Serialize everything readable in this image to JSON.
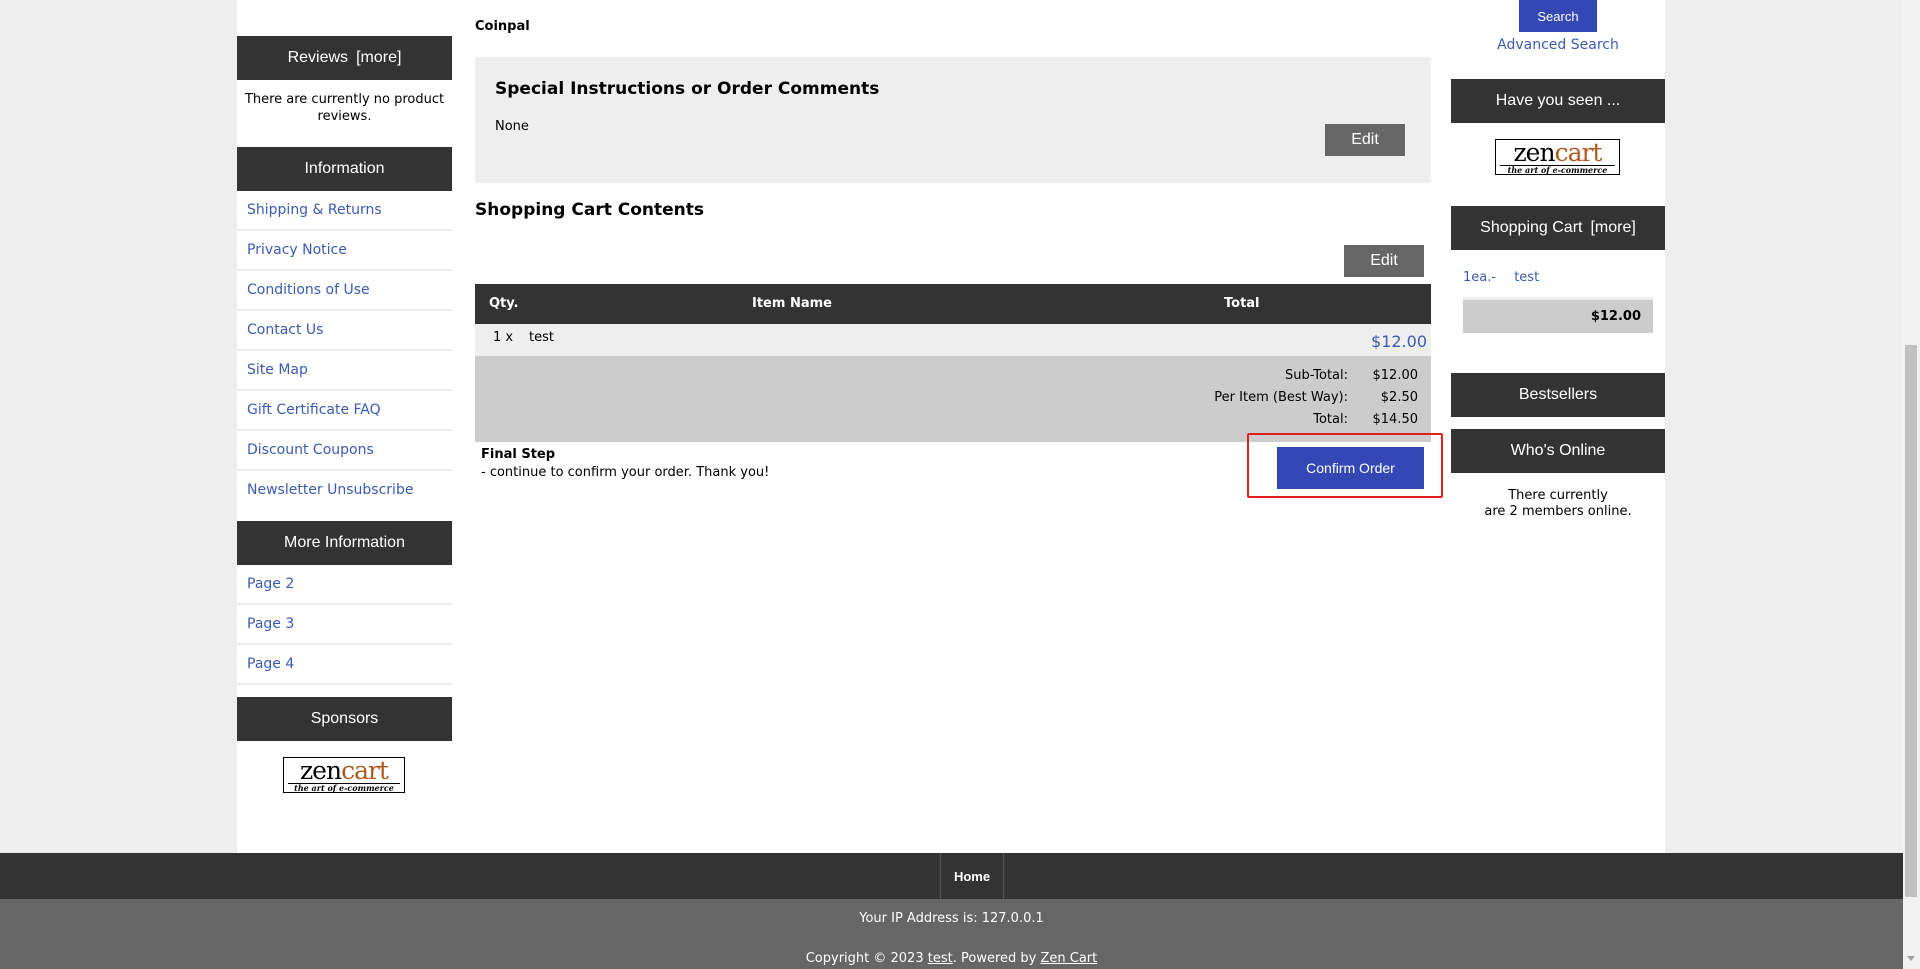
{
  "left": {
    "reviews": {
      "title": "Reviews",
      "more": "[more]",
      "text": "There are currently no product reviews."
    },
    "information": {
      "title": "Information",
      "items": [
        "Shipping & Returns",
        "Privacy Notice",
        "Conditions of Use",
        "Contact Us",
        "Site Map",
        "Gift Certificate FAQ",
        "Discount Coupons",
        "Newsletter Unsubscribe"
      ]
    },
    "more_information": {
      "title": "More Information",
      "items": [
        "Page 2",
        "Page 3",
        "Page 4"
      ]
    },
    "sponsors": {
      "title": "Sponsors"
    }
  },
  "logo": {
    "word1": "zen",
    "word2": "cart",
    "tagline": "the art of e-commerce"
  },
  "main": {
    "payment_method": "Coinpal",
    "comments": {
      "title": "Special Instructions or Order Comments",
      "value": "None",
      "edit_label": "Edit"
    },
    "cart": {
      "title": "Shopping Cart Contents",
      "edit_label": "Edit",
      "columns": {
        "qty": "Qty.",
        "item": "Item Name",
        "total": "Total"
      },
      "row": {
        "qty": "1 x",
        "name": "test",
        "total": "$12.00"
      },
      "totals": [
        {
          "label": "Sub-Total:",
          "value": "$12.00"
        },
        {
          "label": "Per Item (Best Way):",
          "value": "$2.50"
        },
        {
          "label": "Total:",
          "value": "$14.50"
        }
      ]
    },
    "final_step": {
      "title": "Final Step",
      "text": "- continue to confirm your order. Thank you!"
    },
    "confirm_label": "Confirm Order"
  },
  "right": {
    "search_label": "Search",
    "advanced_search": "Advanced Search",
    "have_you_seen": "Have you seen ...",
    "shopping_cart": {
      "title": "Shopping Cart",
      "more": "[more]",
      "item_qty": "1ea.-",
      "item_name": "test",
      "total": "$12.00"
    },
    "bestsellers": "Bestsellers",
    "whos_online": {
      "title": "Who's Online",
      "line1": "There currently",
      "line2": "are 2 members online."
    }
  },
  "footer": {
    "home": "Home",
    "ip": "Your IP Address is: 127.0.0.1",
    "copy_prefix": "Copyright © 2023",
    "store": "test",
    "powered_prefix": ". Powered by",
    "powered_link": "Zen Cart"
  },
  "colors": {
    "header_bg": "#333333",
    "button_blue": "#3348b5",
    "link": "#3b5bb5",
    "highlight": "#e0201b"
  }
}
